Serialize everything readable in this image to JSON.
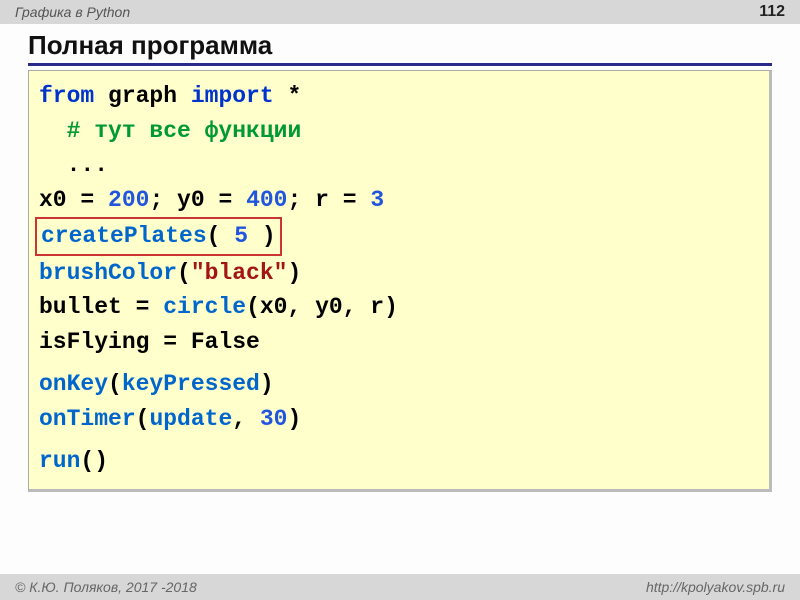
{
  "header": {
    "breadcrumb": "Графика в Python",
    "page_number": "112"
  },
  "title": "Полная программа",
  "code": {
    "l1_from": "from",
    "l1_graph": " graph ",
    "l1_import": "import",
    "l1_star": " *",
    "l2_comment": "  # тут все функции",
    "l3_dots": "  ...",
    "l4_a": "x0 = ",
    "l4_v1": "200",
    "l4_b": "; y0 = ",
    "l4_v2": "400",
    "l4_c": "; r = ",
    "l4_v3": "3",
    "l5_fn": "createPlates",
    "l5_open": "( ",
    "l5_arg": "5",
    "l5_close": " )",
    "l6_fn": "brushColor",
    "l6_open": "(",
    "l6_arg": "\"black\"",
    "l6_close": ")",
    "l7_a": "bullet = ",
    "l7_fn": "circle",
    "l7_args": "(x0, y0, r)",
    "l8": "isFlying = False",
    "l9_fn": "onKey",
    "l9_open": "(",
    "l9_arg": "keyPressed",
    "l9_close": ")",
    "l10_fn": "onTimer",
    "l10_open": "(",
    "l10_arg": "update",
    "l10_sep": ", ",
    "l10_num": "30",
    "l10_close": ")",
    "l11_fn": "run",
    "l11_paren": "()"
  },
  "footer": {
    "copyright": "© К.Ю. Поляков, 2017 -2018",
    "url": "http://kpolyakov.spb.ru"
  }
}
